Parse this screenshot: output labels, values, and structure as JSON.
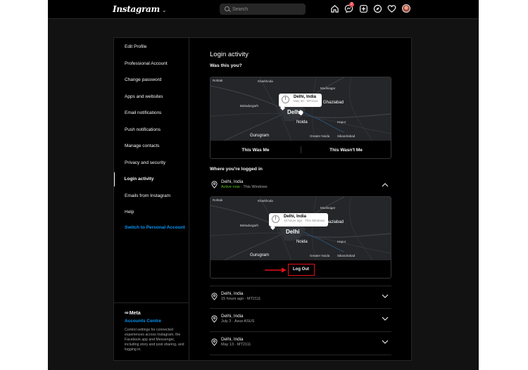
{
  "app": {
    "logo_text": "Instagram"
  },
  "topbar": {
    "search_placeholder": "Search",
    "notification_count": "2",
    "icons": [
      "home-icon",
      "messenger-icon",
      "new-post-icon",
      "explore-icon",
      "heart-icon",
      "avatar"
    ]
  },
  "sidebar": {
    "items": [
      {
        "label": "Edit Profile"
      },
      {
        "label": "Professional Account"
      },
      {
        "label": "Change password"
      },
      {
        "label": "Apps and websites"
      },
      {
        "label": "Email notifications"
      },
      {
        "label": "Push notifications"
      },
      {
        "label": "Manage contacts"
      },
      {
        "label": "Privacy and security"
      },
      {
        "label": "Login activity"
      },
      {
        "label": "Emails from Instagram"
      },
      {
        "label": "Help"
      },
      {
        "label": "Switch to Personal Account"
      }
    ],
    "active_index": 8,
    "meta_logo": "Meta",
    "accounts_centre": "Accounts Centre",
    "accounts_desc": "Control settings for connected experiences across Instagram, the Facebook app and Messenger, including story and post sharing, and logging in."
  },
  "content": {
    "title": "Login activity",
    "question": "Was this you?",
    "where_title": "Where you're logged in",
    "map_labels": {
      "rohtak": "Rohtak",
      "kharkhoda": "Kharkhoda",
      "modinagar": "Modinagar",
      "bahadurgarh": "Bahadurgarh",
      "ghaziabad": "Ghaziabad",
      "delhi": "Delhi",
      "noida": "Noida",
      "hapur": "Hapur",
      "gurugram": "Gurugram",
      "greater_noida": "Greater Noida",
      "sikandrabad": "Sikandrabad"
    },
    "prompt_card": {
      "tip_location": "Delhi, India",
      "tip_time": "May 30 · MT2111",
      "confirm_button": "This Was Me",
      "deny_button": "This Wasn't Me"
    },
    "sessions": [
      {
        "location": "Delhi, India",
        "status": "Active now",
        "device": " · This Windows"
      },
      {
        "location": "Delhi, India",
        "detail": "15 hours ago · MT2111"
      },
      {
        "location": "Delhi, India",
        "detail": "July 3 · Asus ASUS"
      },
      {
        "location": "Delhi, India",
        "detail": "May 13 · MT2111"
      }
    ],
    "expanded_card": {
      "tip_location": "Delhi, India",
      "tip_time": "16 hours ago · This Windows",
      "logout_button": "Log Out"
    }
  },
  "colors": {
    "accent_blue": "#0095f6",
    "active_green": "#58c322",
    "highlight_red": "#e0101a"
  }
}
